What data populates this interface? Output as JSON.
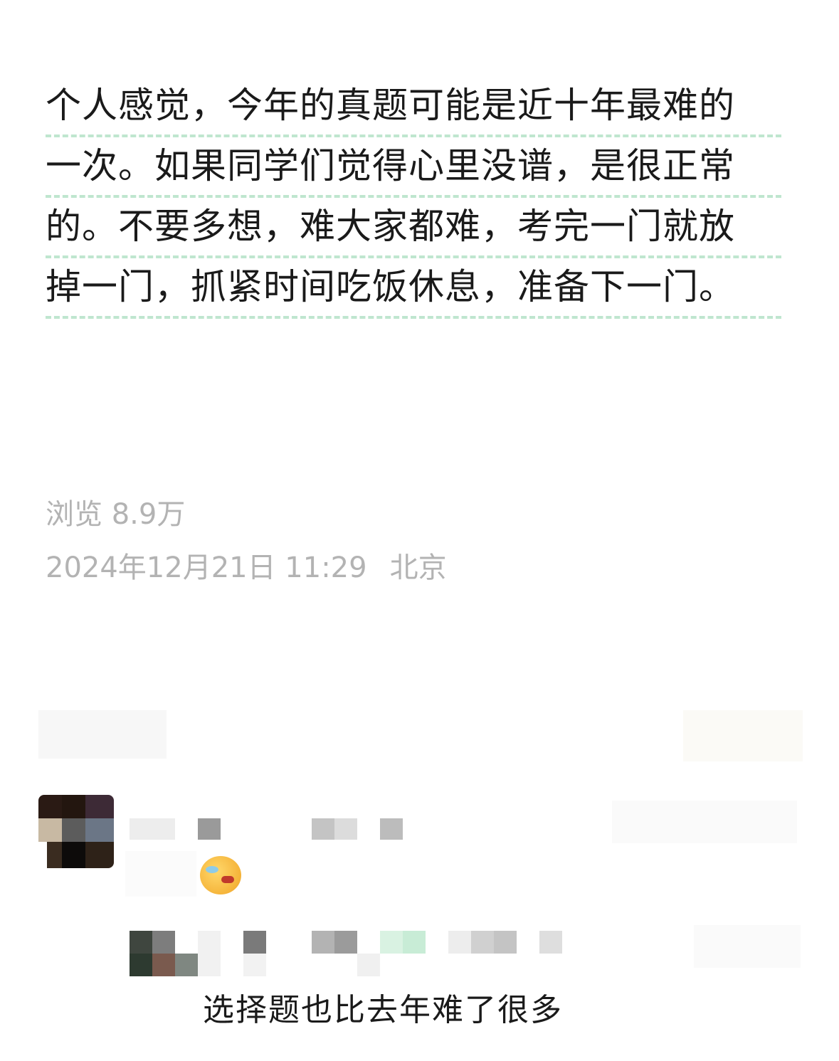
{
  "post": {
    "lines": [
      "个人感觉，今年的真题可能是近十年最难的",
      "一次。如果同学们觉得心里没谱，是很正常",
      "的。不要多想，难大家都难，考完一门就放",
      "掉一门，抓紧时间吃饭休息，准备下一门。"
    ],
    "views": "浏览 8.9万",
    "date": "2024年12月21日 11:29",
    "location": "北京"
  },
  "comment": {
    "avatar_icon": "avatar-pixelated",
    "emoji_icon": "face-with-tears-emoji"
  },
  "reply": {
    "text": "选择题也比去年难了很多"
  }
}
